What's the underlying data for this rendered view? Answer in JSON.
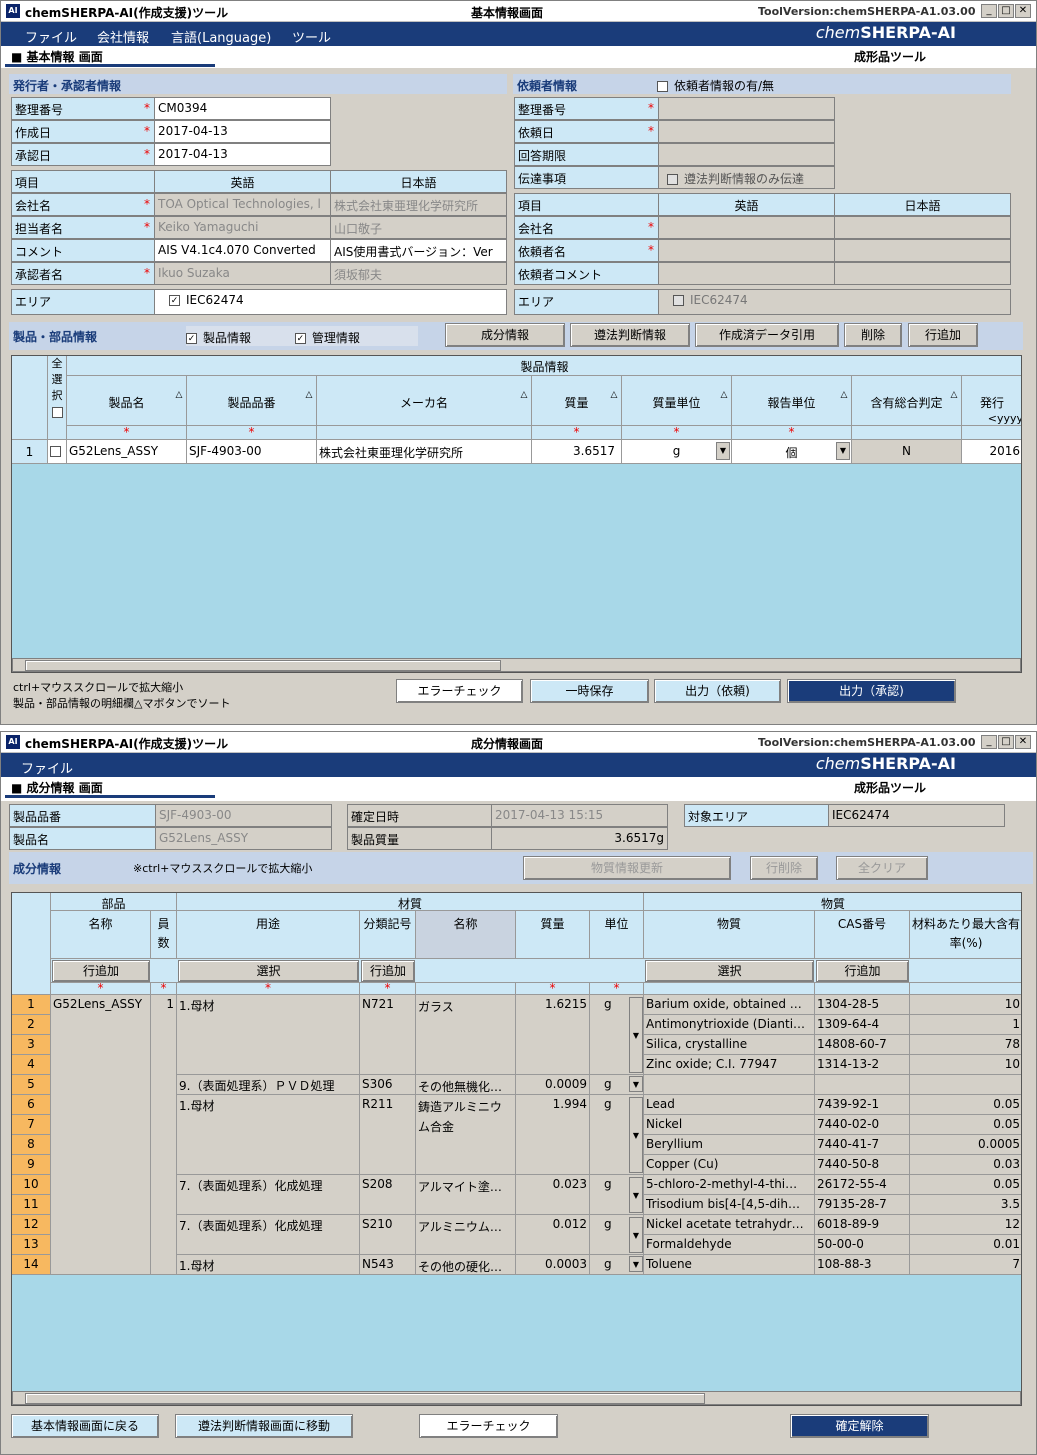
{
  "app_title": "chemSHERPA-AI(作成支援)ツール",
  "tool_version": "ToolVersion:chemSHERPA-A1.03.00",
  "logo": {
    "prefix": "chem",
    "name": "SHERPA-AI"
  },
  "win1": {
    "screen_title": "基本情報画面",
    "menu": [
      "ファイル",
      "会社情報",
      "言語(Language)",
      "ツール"
    ],
    "screen_label": "■ 基本情報 画面",
    "tool_type": "成形品ツール",
    "issuer": {
      "header": "発行者・承認者情報",
      "mgmt_no_label": "整理番号",
      "mgmt_no": "CM0394",
      "created_label": "作成日",
      "created": "2017-04-13",
      "approved_label": "承認日",
      "approved": "2017-04-13",
      "col_item": "項目",
      "col_en": "英語",
      "col_ja": "日本語",
      "rows": [
        {
          "label": "会社名",
          "en": "TOA Optical Technologies, l",
          "ja": "株式会社東亜理化学研究所",
          "req": true,
          "dis": true
        },
        {
          "label": "担当者名",
          "en": "Keiko Yamaguchi",
          "ja": "山口敬子",
          "req": true,
          "dis": true
        },
        {
          "label": "コメント",
          "en": "AIS V4.1c4.070 Converted",
          "ja": "AIS使用書式バージョン：Ver",
          "req": false,
          "dis": false
        },
        {
          "label": "承認者名",
          "en": "Ikuo Suzaka",
          "ja": "須坂郁夫",
          "req": true,
          "dis": true
        }
      ],
      "area_label": "エリア",
      "area_value": "IEC62474"
    },
    "requester": {
      "header": "依頼者情報",
      "checkbox_label": "依頼者情報の有/無",
      "mgmt_no_label": "整理番号",
      "req_date_label": "依頼日",
      "answer_label": "回答期限",
      "notice_label": "伝達事項",
      "notice_check": "遵法判断情報のみ伝達",
      "col_item": "項目",
      "col_en": "英語",
      "col_ja": "日本語",
      "company_label": "会社名",
      "person_label": "依頼者名",
      "comment_label": "依頼者コメント",
      "area_label": "エリア",
      "area_value": "IEC62474"
    },
    "product": {
      "header": "製品・部品情報",
      "check_product": "製品情報",
      "check_mgmt": "管理情報",
      "buttons": [
        "成分情報",
        "遵法判断情報",
        "作成済データ引用",
        "削除",
        "行追加"
      ],
      "group_header": "製品情報",
      "select_all": "全選択",
      "columns": [
        "製品名",
        "製品品番",
        "メーカ名",
        "質量",
        "質量単位",
        "報告単位",
        "含有総合判定",
        "発行"
      ],
      "date_hint": "<yyyy",
      "rows": [
        {
          "no": "1",
          "name": "G52Lens_ASSY",
          "part_no": "SJF-4903-00",
          "maker": "株式会社東亜理化学研究所",
          "mass": "3.6517",
          "unit": "g",
          "report_unit": "個",
          "judge": "N",
          "issue": "2016"
        }
      ]
    },
    "notes": [
      "ctrl+マウススクロールで拡大縮小",
      "製品・部品情報の明細欄△マボタンでソート"
    ],
    "bottom_buttons": [
      "エラーチェック",
      "一時保存",
      "出力（依頼)",
      "出力（承認)"
    ]
  },
  "win2": {
    "screen_title": "成分情報画面",
    "menu": [
      "ファイル"
    ],
    "screen_label": "■ 成分情報 画面",
    "tool_type": "成形品ツール",
    "part_no_label": "製品品番",
    "part_no": "SJF-4903-00",
    "name_label": "製品名",
    "name": "G52Lens_ASSY",
    "fixed_label": "確定日時",
    "fixed": "2017-04-13 15:15",
    "mass_label": "製品質量",
    "mass": "3.6517g",
    "area_label": "対象エリア",
    "area": "IEC62474",
    "comp_header": "成分情報",
    "comp_note": "※ctrl+マウススクロールで拡大縮小",
    "comp_buttons": [
      "物質情報更新",
      "行削除",
      "全クリア"
    ],
    "groups": [
      "部品",
      "材質",
      "物質"
    ],
    "columns": [
      "名称",
      "員数",
      "用途",
      "分類記号",
      "名称",
      "質量",
      "単位",
      "物質",
      "CAS番号",
      "材料あたり最大含有率(%)"
    ],
    "btn_add": "行追加",
    "btn_select": "選択",
    "rows": [
      {
        "no": "1",
        "substance": "Barium oxide, obtained …",
        "cas": "1304-28-5",
        "pct": "10"
      },
      {
        "no": "2",
        "substance": "Antimonytrioxide (Dianti…",
        "cas": "1309-64-4",
        "pct": "1"
      },
      {
        "no": "3",
        "substance": "Silica, crystalline",
        "cas": "14808-60-7",
        "pct": "78"
      },
      {
        "no": "4",
        "substance": "Zinc oxide; C.I. 77947",
        "cas": "1314-13-2",
        "pct": "10"
      },
      {
        "no": "5",
        "substance": "",
        "cas": "",
        "pct": ""
      },
      {
        "no": "6",
        "substance": "Lead",
        "cas": "7439-92-1",
        "pct": "0.05"
      },
      {
        "no": "7",
        "substance": "Nickel",
        "cas": "7440-02-0",
        "pct": "0.05"
      },
      {
        "no": "8",
        "substance": "Beryllium",
        "cas": "7440-41-7",
        "pct": "0.0005"
      },
      {
        "no": "9",
        "substance": "Copper (Cu)",
        "cas": "7440-50-8",
        "pct": "0.03"
      },
      {
        "no": "10",
        "substance": "5-chloro-2-methyl-4-thi…",
        "cas": "26172-55-4",
        "pct": "0.05"
      },
      {
        "no": "11",
        "substance": "Trisodium bis[4-[4,5-dih…",
        "cas": "79135-28-7",
        "pct": "3.5"
      },
      {
        "no": "12",
        "substance": "Nickel acetate tetrahydr…",
        "cas": "6018-89-9",
        "pct": "12"
      },
      {
        "no": "13",
        "substance": "Formaldehyde",
        "cas": "50-00-0",
        "pct": "0.01"
      },
      {
        "no": "14",
        "substance": "Toluene",
        "cas": "108-88-3",
        "pct": "7"
      }
    ],
    "part": {
      "name": "G52Lens_ASSY",
      "qty": "1"
    },
    "materials": [
      {
        "use": "1.母材",
        "code": "N721",
        "name": "ガラス",
        "mass": "1.6215",
        "unit": "g"
      },
      {
        "use": "9.（表面処理系）ＰＶＤ処理",
        "code": "S306",
        "name": "その他無機化…",
        "mass": "0.0009",
        "unit": "g"
      },
      {
        "use": "1.母材",
        "code": "R211",
        "name": "鋳造アルミニウム合金",
        "mass": "1.994",
        "unit": "g"
      },
      {
        "use": "7.（表面処理系）化成処理",
        "code": "S208",
        "name": "アルマイト塗…",
        "mass": "0.023",
        "unit": "g"
      },
      {
        "use": "7.（表面処理系）化成処理",
        "code": "S210",
        "name": "アルミニウム…",
        "mass": "0.012",
        "unit": "g"
      },
      {
        "use": "1.母材",
        "code": "N543",
        "name": "その他の硬化…",
        "mass": "0.0003",
        "unit": "g"
      }
    ],
    "bottom_buttons": [
      "基本情報画面に戻る",
      "遵法判断情報画面に移動",
      "エラーチェック",
      "確定解除"
    ]
  }
}
